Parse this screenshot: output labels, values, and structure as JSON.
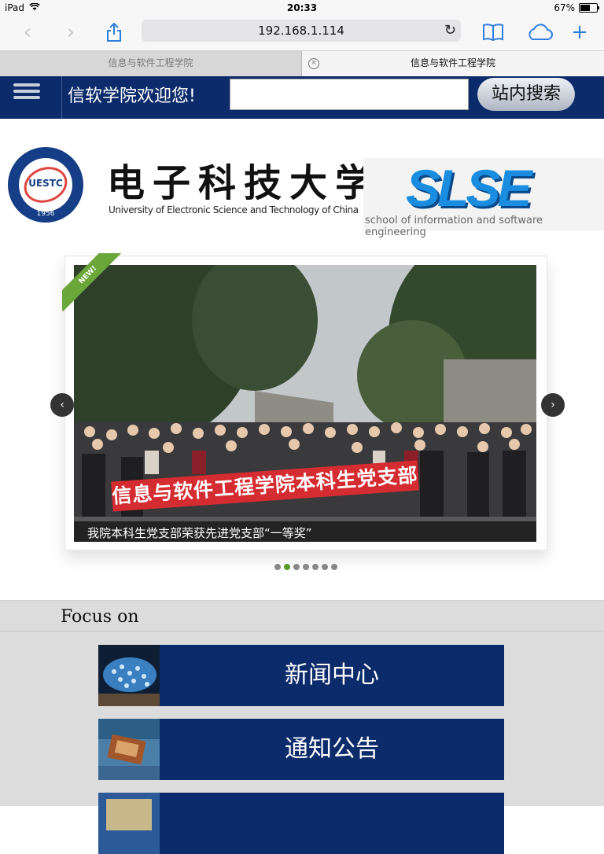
{
  "status": {
    "device": "iPad",
    "time": "20:33",
    "battery": "67%",
    "battery_level": 0.67
  },
  "browser": {
    "url": "192.168.1.114",
    "tabs": [
      {
        "title": "信息与软件工程学院"
      },
      {
        "title": "信息与软件工程学院"
      }
    ]
  },
  "header": {
    "welcome": "信软学院欢迎您!",
    "search_button": "站内搜索",
    "search_placeholder": ""
  },
  "logos": {
    "uestc_badge_text": "UESTC",
    "uestc_badge_year": "1956",
    "university_cn": "电子科技大学",
    "university_en": "University of Electronic Science and Technology of China",
    "slse_text": "SLSE",
    "slse_sub": "school of information and software engineering"
  },
  "slider": {
    "ribbon": "NEW!",
    "banner_text": "信息与软件工程学院本科生党支部",
    "caption": "我院本科生党支部荣获先进党支部“一等奖”",
    "dot_count": 7,
    "active_dot": 1
  },
  "focus": {
    "title": "Focus on",
    "items": [
      {
        "label": "新闻中心"
      },
      {
        "label": "通知公告"
      },
      {
        "label": ""
      }
    ]
  }
}
